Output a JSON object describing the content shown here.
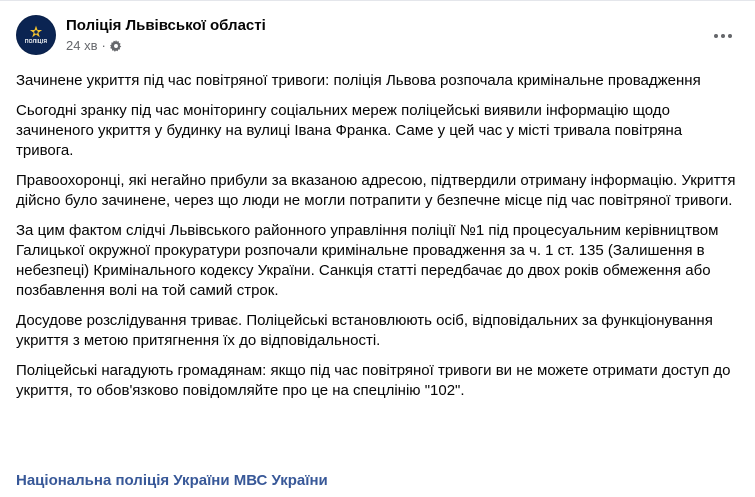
{
  "post": {
    "author": "Поліція Львівської області",
    "avatar_text": "ПОЛІЦІЯ",
    "time": "24 хв",
    "separator": "·",
    "more_menu_icon": "more-horizontal-icon",
    "privacy_icon": "settings-gear-icon",
    "paragraphs": [
      "Зачинене укриття під час повітряної тривоги: поліція Львова розпочала кримінальне провадження",
      "Сьогодні зранку під час моніторингу соціальних мереж поліцейські виявили інформацію щодо зачиненого укриття у будинку на вулиці Івана Франка. Саме у цей час у місті тривала повітряна тривога.",
      "Правоохоронці, які негайно прибули за вказаною адресою, підтвердили отриману інформацію. Укриття дійсно було зачинене, через що люди не могли потрапити у безпечне місце під час повітряної тривоги.",
      "За цим фактом слідчі Львівського районного управління поліції №1 під процесуальним керівництвом Галицької окружної прокуратури розпочали кримінальне провадження за ч. 1 ст. 135 (Залишення в небезпеці) Кримінального кодексу України. Санкція статті передбачає до двох років обмеження або позбавлення волі на той самий строк.",
      "Досудове розслідування триває. Поліцейські встановлюють осіб, відповідальних за функціонування укриття з метою притягнення їх до відповідальності.",
      "Поліцейські нагадують громадянам: якщо під час повітряної тривоги ви не можете отримати доступ до  укриття, то обов'язково повідомляйте про це на спецлінію \"102\"."
    ],
    "tag_link": "Національна поліція України МВС України"
  },
  "colors": {
    "text": "#050505",
    "secondary": "#65676b",
    "link": "#385898",
    "avatar_bg": "#0b2452"
  }
}
